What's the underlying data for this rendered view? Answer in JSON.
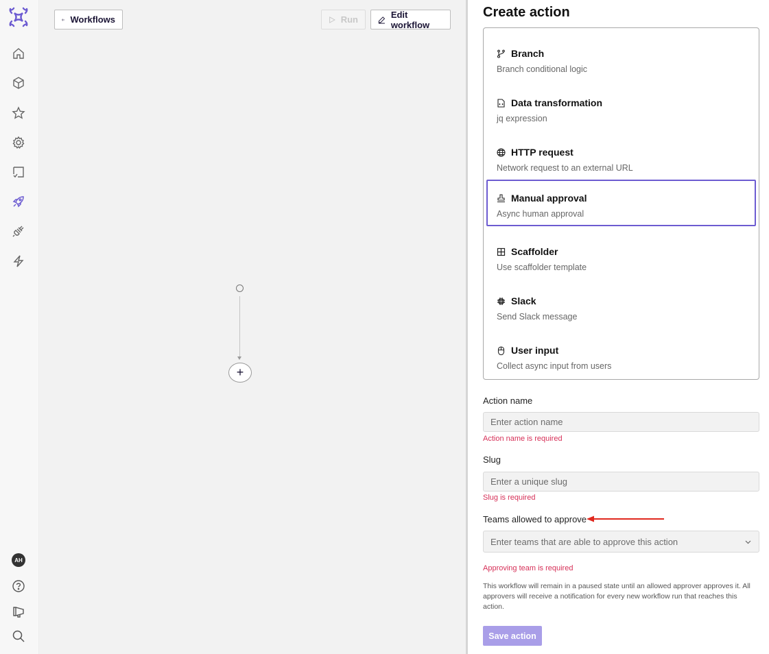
{
  "sidebar": {
    "brand_color": "#6c5bd1",
    "items": [
      {
        "name": "home",
        "icon": "home-icon"
      },
      {
        "name": "catalog",
        "icon": "cube-icon"
      },
      {
        "name": "favorites",
        "icon": "star-icon"
      },
      {
        "name": "settings",
        "icon": "gear-icon"
      },
      {
        "name": "scorecards",
        "icon": "checklist-icon"
      },
      {
        "name": "workflows",
        "icon": "rocket-icon",
        "active": true
      },
      {
        "name": "integrations",
        "icon": "plug-icon"
      },
      {
        "name": "actions",
        "icon": "lightning-icon"
      }
    ],
    "avatar_initials": "AH",
    "bottom": [
      {
        "name": "help",
        "icon": "help-icon"
      },
      {
        "name": "announcements",
        "icon": "megaphone-icon"
      },
      {
        "name": "search",
        "icon": "search-icon"
      }
    ]
  },
  "canvas": {
    "back_button": "Workflows",
    "run_button": "Run",
    "edit_button": "Edit workflow",
    "add_step": "+"
  },
  "panel": {
    "title": "Create action",
    "actions": [
      {
        "title": "Branch",
        "description": "Branch conditional logic",
        "icon": "branch-icon"
      },
      {
        "title": "Data transformation",
        "description": "jq expression",
        "icon": "code-file-icon"
      },
      {
        "title": "HTTP request",
        "description": "Network request to an external URL",
        "icon": "globe-icon"
      },
      {
        "title": "Manual approval",
        "description": "Async human approval",
        "icon": "stamp-icon",
        "selected": true
      },
      {
        "title": "Scaffolder",
        "description": "Use scaffolder template",
        "icon": "grid-icon"
      },
      {
        "title": "Slack",
        "description": "Send Slack message",
        "icon": "slack-icon"
      },
      {
        "title": "User input",
        "description": "Collect async input from users",
        "icon": "mouse-icon"
      }
    ],
    "form": {
      "action_name_label": "Action name",
      "action_name_placeholder": "Enter action name",
      "action_name_value": "",
      "action_name_error": "Action name is required",
      "slug_label": "Slug",
      "slug_placeholder": "Enter a unique slug",
      "slug_value": "",
      "slug_error": "Slug is required",
      "teams_label": "Teams allowed to approve",
      "teams_placeholder": "Enter teams that are able to approve this action",
      "teams_error": "Approving team is required",
      "help_text": "This workflow will remain in a paused state until an allowed approver approves it. All approvers will receive a notification for every new workflow run that reaches this action.",
      "save_button": "Save action"
    },
    "error_color": "#d62f57",
    "annotation_arrow_color": "#e0281e"
  }
}
